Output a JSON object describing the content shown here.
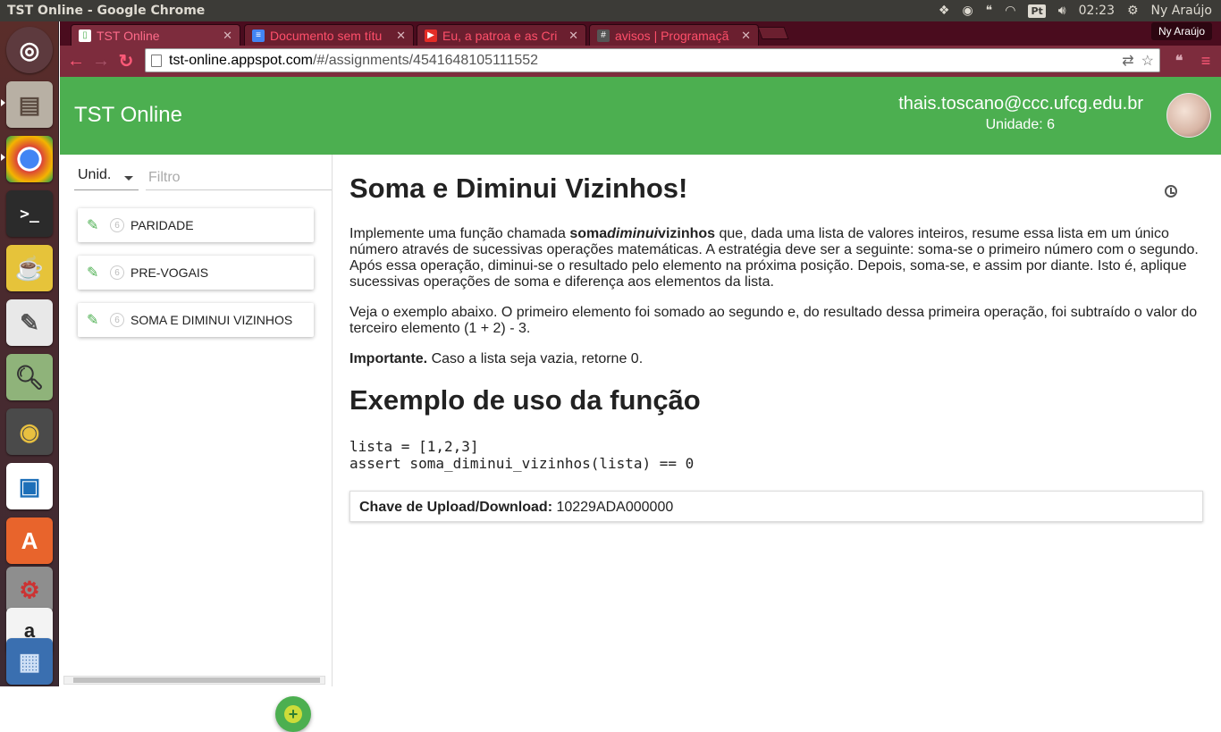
{
  "system_panel": {
    "window_title": "TST Online - Google Chrome",
    "keyboard_layout": "Pt",
    "clock": "02:23",
    "user_name": "Ny Araújo",
    "icons": [
      "dropbox-icon",
      "chrome-icon",
      "chat-icon",
      "wifi-icon",
      "keyboard-icon",
      "volume-icon",
      "settings-gear-icon"
    ]
  },
  "launcher": {
    "items": [
      "ubuntu-dash",
      "files",
      "chrome",
      "terminal",
      "tea",
      "text-editor",
      "image-viewer",
      "music",
      "libreoffice-impress",
      "software-center",
      "system-settings",
      "amazon",
      "workspaces"
    ]
  },
  "browser": {
    "profile_name": "Ny Araújo",
    "tabs": [
      {
        "label": "TST Online",
        "favicon_color": "#4caf50",
        "active": true
      },
      {
        "label": "Documento sem títu",
        "favicon_color": "#4285f4",
        "active": false
      },
      {
        "label": "Eu, a patroa e as Cri",
        "favicon_color": "#e52d27",
        "active": false
      },
      {
        "label": "avisos | Programaçã",
        "favicon_color": "#555555",
        "active": false
      }
    ],
    "address": {
      "host": "tst-online.appspot.com",
      "path": "/#/assignments/4541648105111552"
    }
  },
  "app": {
    "title": "TST Online",
    "user_email": "thais.toscano@ccc.ufcg.edu.br",
    "unit_label": "Unidade: 6",
    "accent_color": "#4caf50"
  },
  "sidebar": {
    "unit_select": "Unid.",
    "filter_placeholder": "Filtro",
    "items": [
      {
        "label": "PARIDADE",
        "badge": "6"
      },
      {
        "label": "PRE-VOGAIS",
        "badge": "6"
      },
      {
        "label": "SOMA E DIMINUI VIZINHOS",
        "badge": "6"
      }
    ],
    "fab_symbol": "+"
  },
  "assignment": {
    "title": "Soma e Diminui Vizinhos!",
    "intro_before": "Implemente uma função chamada ",
    "fn_part1": "soma",
    "fn_part2": "diminui",
    "fn_part3": "vizinhos",
    "intro_after": " que, dada uma lista de valores inteiros, resume essa lista em um único número através de sucessivas operações matemáticas. A estratégia deve ser a seguinte: soma-se o primeiro número com o segundo. Após essa operação, diminui-se o resultado pelo elemento na próxima posição. Depois, soma-se, e assim por diante. Isto é, aplique sucessivas operações de soma e diferença aos elementos da lista.",
    "example_text": "Veja o exemplo abaixo. O primeiro elemento foi somado ao segundo e, do resultado dessa primeira operação, foi subtraído o valor do terceiro elemento (1 + 2) - 3.",
    "important_label": "Importante.",
    "important_text": " Caso a lista seja vazia, retorne 0.",
    "example_heading": "Exemplo de uso da função",
    "code_line1": "lista = [1,2,3]",
    "code_line2": "assert soma_diminui_vizinhos(lista) == 0",
    "key_label": "Chave de Upload/Download:",
    "key_value": " 10229ADA000000"
  }
}
